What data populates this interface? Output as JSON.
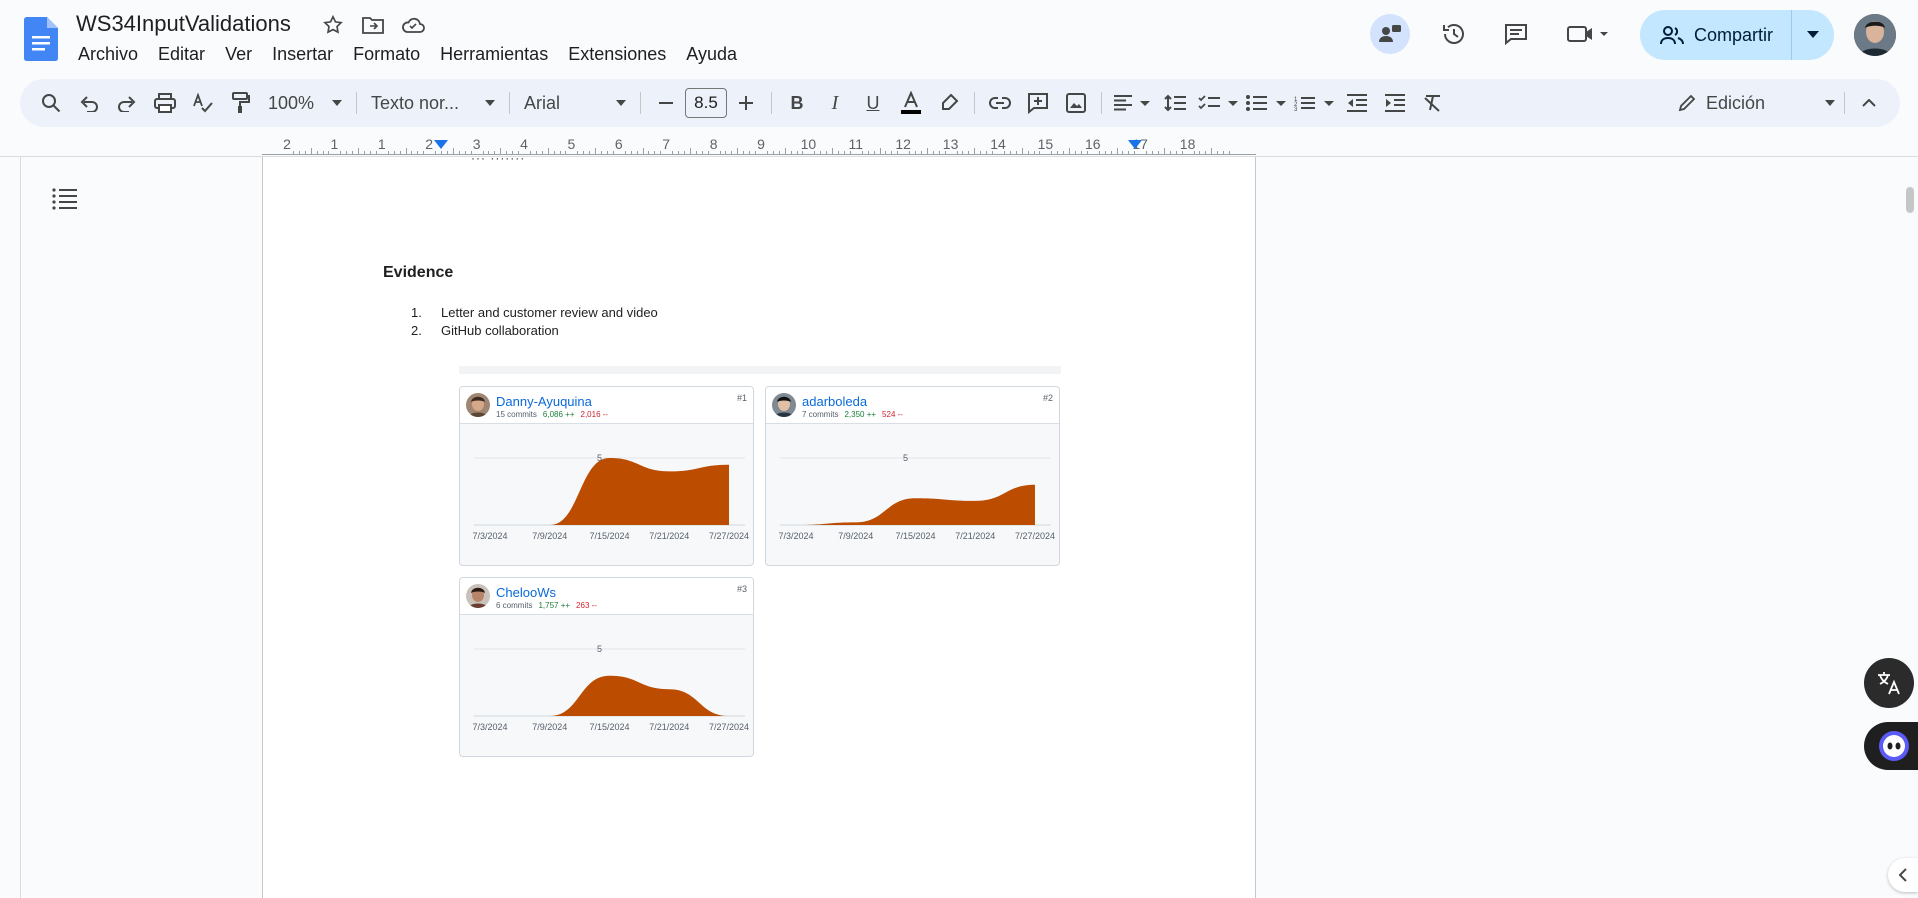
{
  "app": {
    "doc_title": "WS34InputValidations",
    "menu": [
      "Archivo",
      "Editar",
      "Ver",
      "Insertar",
      "Formato",
      "Herramientas",
      "Extensiones",
      "Ayuda"
    ],
    "share_label": "Compartir"
  },
  "toolbar": {
    "zoom": "100%",
    "style": "Texto nor...",
    "font": "Arial",
    "font_size": "8.5",
    "mode": "Edición"
  },
  "ruler": {
    "labels": [
      "2",
      "1",
      "1",
      "2",
      "3",
      "4",
      "5",
      "6",
      "7",
      "8",
      "9",
      "10",
      "11",
      "12",
      "13",
      "14",
      "15",
      "16",
      "17",
      "18"
    ]
  },
  "document": {
    "heading": "Evidence",
    "list": [
      {
        "num": "1.",
        "text": "Letter and customer review and video"
      },
      {
        "num": "2.",
        "text": "GitHub collaboration"
      }
    ]
  },
  "contributors": [
    {
      "name": "Danny-Ayuquina",
      "commits": "15 commits",
      "additions": "6,086 ++",
      "deletions": "2,016 --",
      "rank": "#1"
    },
    {
      "name": "adarboleda",
      "commits": "7 commits",
      "additions": "2,350 ++",
      "deletions": "524 --",
      "rank": "#2"
    },
    {
      "name": "ChelooWs",
      "commits": "6 commits",
      "additions": "1,757 ++",
      "deletions": "263 --",
      "rank": "#3"
    }
  ],
  "chart_data": [
    {
      "type": "area",
      "title": "Danny-Ayuquina",
      "x": [
        "7/3/2024",
        "7/9/2024",
        "7/15/2024",
        "7/21/2024",
        "7/27/2024"
      ],
      "y_tick": "5",
      "values": [
        0,
        0,
        5,
        4,
        4.5
      ],
      "color": "#bc4c00"
    },
    {
      "type": "area",
      "title": "adarboleda",
      "x": [
        "7/3/2024",
        "7/9/2024",
        "7/15/2024",
        "7/21/2024",
        "7/27/2024"
      ],
      "y_tick": "5",
      "values": [
        0,
        0.2,
        2,
        1.8,
        3
      ],
      "color": "#bc4c00"
    },
    {
      "type": "area",
      "title": "ChelooWs",
      "x": [
        "7/3/2024",
        "7/9/2024",
        "7/15/2024",
        "7/21/2024",
        "7/27/2024"
      ],
      "y_tick": "5",
      "values": [
        0,
        0,
        3,
        2,
        0
      ],
      "color": "#bc4c00"
    }
  ]
}
